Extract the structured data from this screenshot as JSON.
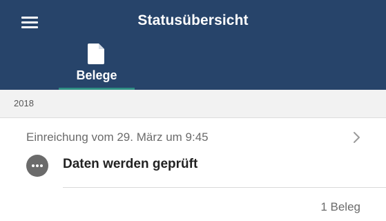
{
  "header": {
    "title": "Statusübersicht",
    "background_color": "#27446a",
    "menu_icon": "hamburger-menu-icon"
  },
  "tabs": [
    {
      "label": "Belege",
      "icon": "document-icon",
      "active": true,
      "indicator_color": "#2f8f84"
    }
  ],
  "section": {
    "year": "2018"
  },
  "entries": [
    {
      "date": "Einreichung vom 29. März um 9:45",
      "status_icon": "more-dots-icon",
      "status": "Daten werden geprüft",
      "count": "1 Beleg"
    }
  ]
}
